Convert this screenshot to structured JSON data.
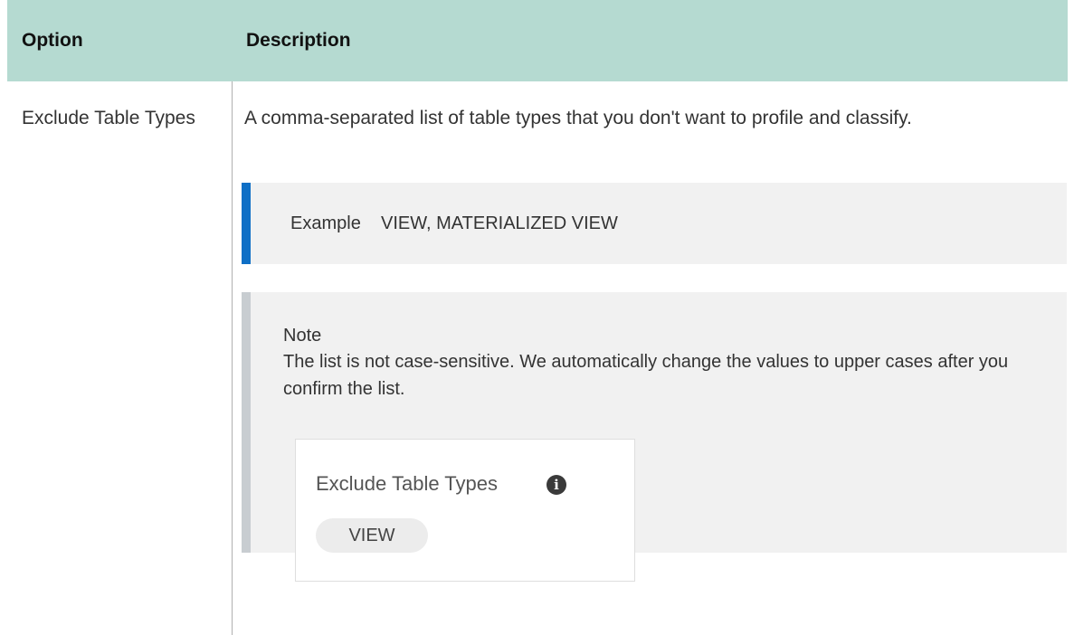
{
  "table": {
    "headers": {
      "option": "Option",
      "description": "Description"
    },
    "rows": [
      {
        "option": "Exclude Table Types",
        "description": "A comma-separated list of table types that you don't want to profile and classify.",
        "example": {
          "label": "Example",
          "value": "VIEW, MATERIALIZED VIEW"
        },
        "note": {
          "title": "Note",
          "text": "The list is not case-sensitive. We automatically change the values to upper cases after you confirm the list.",
          "screenshot": {
            "field_label": "Exclude Table Types",
            "info_icon": "info-icon",
            "chip": "VIEW"
          }
        }
      }
    ]
  },
  "colors": {
    "header_bg": "#b5dad1",
    "example_accent": "#0e6fc6",
    "note_accent": "#c8cdd1",
    "callout_bg": "#f1f1f1"
  }
}
